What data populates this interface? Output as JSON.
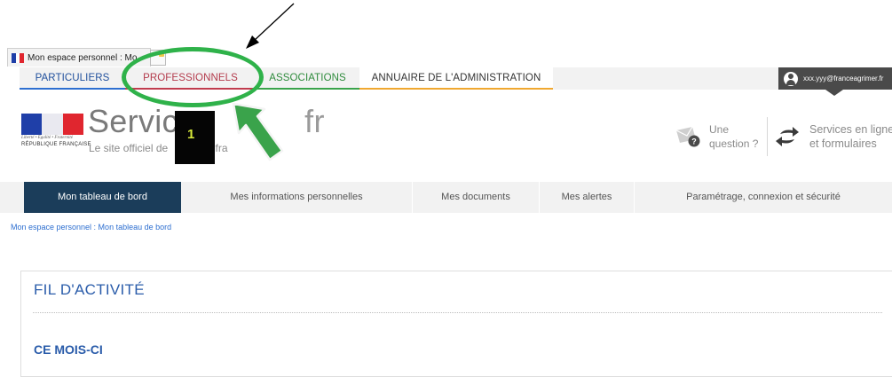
{
  "browser": {
    "tab_title": "Mon espace personnel : Mo",
    "tab_icon": "french-flag-icon"
  },
  "topnav": {
    "items": [
      {
        "label": "PARTICULIERS",
        "color": "#2e6fd0"
      },
      {
        "label": "PROFESSIONNELS",
        "color": "#c03c4e"
      },
      {
        "label": "ASSOCIATIONS",
        "color": "#3aa34b"
      },
      {
        "label": "ANNUAIRE DE L'ADMINISTRATION",
        "color": "#f0a830"
      }
    ],
    "user_email": "xxx.yyy@franceagrimer.fr"
  },
  "header": {
    "logo_motto": "Liberté • Égalité • Fraternité",
    "logo_republic": "RÉPUBLIQUE FRANÇAISE",
    "site_name": "Service",
    "site_name_ext": "fr",
    "tagline": "Le site officiel de",
    "tagline_end": "ation fra",
    "question_line1": "Une",
    "question_line2": "question ?",
    "services_line1": "Services en ligne",
    "services_line2": "et formulaires"
  },
  "mainmenu": {
    "items": [
      {
        "label": "Mon tableau de bord",
        "active": true
      },
      {
        "label": "Mes informations personnelles",
        "active": false
      },
      {
        "label": "Mes documents",
        "active": false
      },
      {
        "label": "Mes alertes",
        "active": false
      },
      {
        "label": "Paramétrage, connexion et sécurité",
        "active": false
      }
    ]
  },
  "breadcrumb": "Mon espace personnel : Mon tableau de bord",
  "activity": {
    "title": "FIL D'ACTIVITÉ",
    "section": "CE MOIS-CI"
  },
  "annotation": {
    "step_number": "1",
    "highlight_color": "#2fb24a",
    "arrow_color": "#3aa34b"
  },
  "colors": {
    "menu_active_bg": "#1b3d5a",
    "accent_blue": "#2a5caa"
  }
}
